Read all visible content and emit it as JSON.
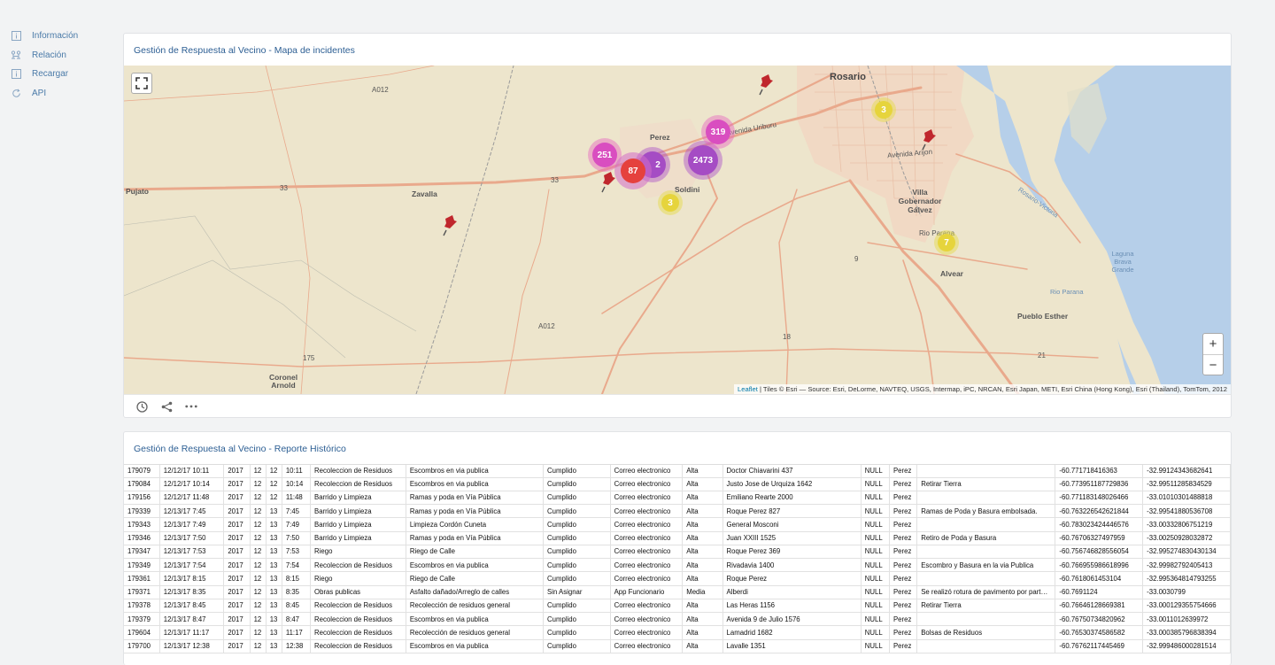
{
  "sidebar": {
    "items": [
      {
        "label": "Información",
        "icon": "info-icon"
      },
      {
        "label": "Relación",
        "icon": "relation-icon"
      },
      {
        "label": "Recargar",
        "icon": "info-icon"
      },
      {
        "label": "API",
        "icon": "refresh-icon"
      }
    ]
  },
  "map_panel": {
    "title": "Gestión de Respuesta al Vecino - Mapa de incidentes",
    "zoom_in": "+",
    "zoom_out": "−",
    "attribution_link": "Leaflet",
    "attribution_text": " | Tiles © Esri — Source: Esri, DeLorme, NAVTEQ, USGS, Intermap, iPC, NRCAN, Esri Japan, METI, Esri China (Hong Kong), Esri (Thailand), TomTom, 2012",
    "clusters": [
      "251",
      "2",
      "87",
      "2473",
      "319",
      "3",
      "3",
      "7"
    ],
    "labels": {
      "rosario": "Rosario",
      "perez": "Perez",
      "soldini": "Soldini",
      "zavalla": "Zavalla",
      "pujato": "Pujato",
      "villa_gobernador_galvez": "Villa Gobernador Gálvez",
      "alvear": "Alvear",
      "coronel_arnold": "Coronel Arnold",
      "pueblo_esther": "Pueblo Esther",
      "rio_parana": "Rio Parana",
      "laguna": "Laguna Brava Grande",
      "rosario_victoria": "Rosario-Victoria",
      "avenida_uriburu": "Avenida Uriburu",
      "avenida_arijon": "Avenida Arijon",
      "rio_parana_small": "Rio Parana",
      "r33a": "33",
      "r33b": "33",
      "r9": "9",
      "r18": "18",
      "r21": "21",
      "rA012a": "A012",
      "rA012b": "A012",
      "r175": "175"
    }
  },
  "table_panel": {
    "title": "Gestión de Respuesta al Vecino - Reporte Histórico",
    "rows": [
      [
        "179079",
        "12/12/17 10:11",
        "2017",
        "12",
        "12",
        "10:11",
        "Recoleccion de Residuos",
        "Escombros en via publica",
        "Cumplido",
        "Correo electronico",
        "Alta",
        "Doctor Chiavarini 437",
        "NULL",
        "Perez",
        "",
        "-60.771718416363",
        "-32.99124343682641"
      ],
      [
        "179084",
        "12/12/17 10:14",
        "2017",
        "12",
        "12",
        "10:14",
        "Recoleccion de Residuos",
        "Escombros en via publica",
        "Cumplido",
        "Correo electronico",
        "Alta",
        "Justo Jose de Urquiza 1642",
        "NULL",
        "Perez",
        "Retirar Tierra",
        "-60.77395118772983​6",
        "-32.99511285834529"
      ],
      [
        "179156",
        "12/12/17 11:48",
        "2017",
        "12",
        "12",
        "11:48",
        "Barrido y Limpieza",
        "Ramas y poda en Vía Pública",
        "Cumplido",
        "Correo electronico",
        "Alta",
        "Emiliano Rearte 2000",
        "NULL",
        "Perez",
        "",
        "-60.771183148026466",
        "-33.01010301488818"
      ],
      [
        "179339",
        "12/13/17 7:45",
        "2017",
        "12",
        "13",
        "7:45",
        "Barrido y Limpieza",
        "Ramas y poda en Vía Pública",
        "Cumplido",
        "Correo electronico",
        "Alta",
        "Roque Perez 827",
        "NULL",
        "Perez",
        "Ramas de Poda y Basura embolsada.",
        "-60.763226542621844",
        "-32.99541880536708"
      ],
      [
        "179343",
        "12/13/17 7:49",
        "2017",
        "12",
        "13",
        "7:49",
        "Barrido y Limpieza",
        "Limpieza Cordón Cuneta",
        "Cumplido",
        "Correo electronico",
        "Alta",
        "General Mosconi",
        "NULL",
        "Perez",
        "",
        "-60.783023424446576",
        "-33.00332806751219"
      ],
      [
        "179346",
        "12/13/17 7:50",
        "2017",
        "12",
        "13",
        "7:50",
        "Barrido y Limpieza",
        "Ramas y poda en Vía Pública",
        "Cumplido",
        "Correo electronico",
        "Alta",
        "Juan XXIII 1525",
        "NULL",
        "Perez",
        "Retiro de Poda y Basura",
        "-60.76706327497959",
        "-33.00250928032872"
      ],
      [
        "179347",
        "12/13/17 7:53",
        "2017",
        "12",
        "13",
        "7:53",
        "Riego",
        "Riego de Calle",
        "Cumplido",
        "Correo electronico",
        "Alta",
        "Roque Perez 369",
        "NULL",
        "Perez",
        "",
        "-60.756746828556054",
        "-32.995274830430134"
      ],
      [
        "179349",
        "12/13/17 7:54",
        "2017",
        "12",
        "13",
        "7:54",
        "Recoleccion de Residuos",
        "Escombros en via publica",
        "Cumplido",
        "Correo electronico",
        "Alta",
        "Rivadavia 1400",
        "NULL",
        "Perez",
        "Escombro y Basura en la via Publica",
        "-60.766955986618996",
        "-32.99982792405413"
      ],
      [
        "179361",
        "12/13/17 8:15",
        "2017",
        "12",
        "13",
        "8:15",
        "Riego",
        "Riego de Calle",
        "Cumplido",
        "Correo electronico",
        "Alta",
        "Roque Perez",
        "NULL",
        "Perez",
        "",
        "-60.7618061453104",
        "-32.995364814793255"
      ],
      [
        "179371",
        "12/13/17 8:35",
        "2017",
        "12",
        "13",
        "8:35",
        "Obras publicas",
        "Asfalto dañado/Arreglo de calles",
        "Sin Asignar",
        "App Funcionario",
        "Media",
        "Alberdi",
        "NULL",
        "Perez",
        "Se realizó rotura de pavimento por parte de Aguas Santafesinas",
        "-60.7691124",
        "-33.0030799"
      ],
      [
        "179378",
        "12/13/17 8:45",
        "2017",
        "12",
        "13",
        "8:45",
        "Recoleccion de Residuos",
        "Recolección de residuos general",
        "Cumplido",
        "Correo electronico",
        "Alta",
        "Las Heras 1156",
        "NULL",
        "Perez",
        "Retirar Tierra",
        "-60.76646128669381",
        "-33.000129355754666"
      ],
      [
        "179379",
        "12/13/17 8:47",
        "2017",
        "12",
        "13",
        "8:47",
        "Recoleccion de Residuos",
        "Escombros en via publica",
        "Cumplido",
        "Correo electronico",
        "Alta",
        "Avenida 9 de Julio 1576",
        "NULL",
        "Perez",
        "",
        "-60.767507348209​62",
        "-33.0011012639972"
      ],
      [
        "179604",
        "12/13/17 11:17",
        "2017",
        "12",
        "13",
        "11:17",
        "Recoleccion de Residuos",
        "Recolección de residuos general",
        "Cumplido",
        "Correo electronico",
        "Alta",
        "Lamadrid 1682",
        "NULL",
        "Perez",
        "Bolsas de Residuos",
        "-60.76530374586582",
        "-33.000385796838394"
      ],
      [
        "179700",
        "12/13/17 12:38",
        "2017",
        "12",
        "13",
        "12:38",
        "Recoleccion de Residuos",
        "Escombros en via publica",
        "Cumplido",
        "Correo electronico",
        "Alta",
        "Lavalle 1351",
        "NULL",
        "Perez",
        "",
        "-60.76762117445469",
        "-32.999486000281514"
      ]
    ]
  }
}
